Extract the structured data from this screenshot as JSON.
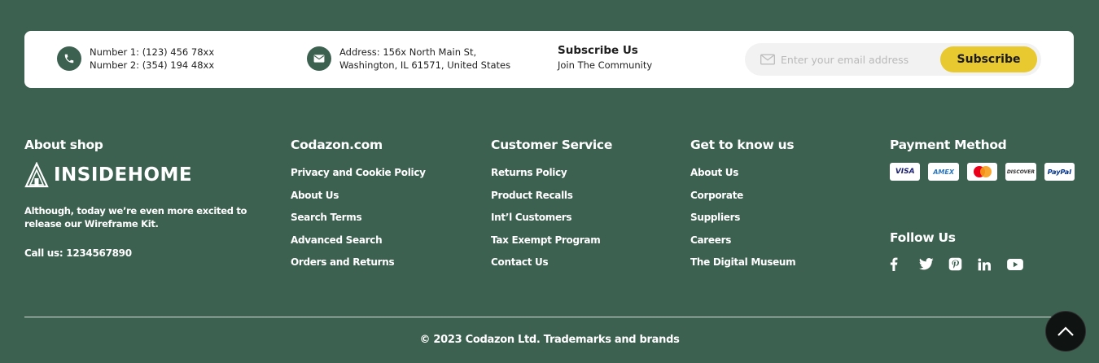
{
  "contact": {
    "phone_line1": "Number 1: (123) 456 78xx",
    "phone_line2": "Number 2: (354) 194 48xx",
    "address_line1": "Address: 156x North Main St,",
    "address_line2": "Washington, IL 61571, United States"
  },
  "subscribe": {
    "title": "Subscribe Us",
    "subtitle": "Join The Community",
    "email_placeholder": "Enter your email address",
    "email_value": "",
    "button_label": "Subscribe",
    "button_color": "#e8c930"
  },
  "about": {
    "heading": "About shop",
    "logo_text": "INSIDEHOME",
    "description": "Although, today we’re even more excited to release our Wireframe Kit.",
    "call": "Call us: 1234567890"
  },
  "columns": [
    {
      "heading": "Codazon.com",
      "links": [
        "Privacy and Cookie Policy",
        "About Us",
        "Search Terms",
        "Advanced Search",
        "Orders and Returns"
      ]
    },
    {
      "heading": "Customer Service",
      "links": [
        "Returns Policy",
        "Product Recalls",
        "Int’l Customers",
        "Tax Exempt Program",
        "Contact Us"
      ]
    },
    {
      "heading": "Get to know us",
      "links": [
        "About Us",
        "Corporate",
        "Suppliers",
        "Careers",
        "The Digital Museum"
      ]
    }
  ],
  "payment": {
    "heading": "Payment Method",
    "cards": [
      "VISA",
      "AMEX",
      "MasterCard",
      "DISCOVER",
      "PayPal"
    ]
  },
  "follow": {
    "heading": "Follow Us",
    "icons": [
      "facebook-icon",
      "twitter-icon",
      "pinterest-icon",
      "linkedin-icon",
      "youtube-icon"
    ]
  },
  "copyright": "© 2023 Codazon Ltd. Trademarks and brands",
  "colors": {
    "background": "#3d6150",
    "accent": "#e8c930"
  }
}
